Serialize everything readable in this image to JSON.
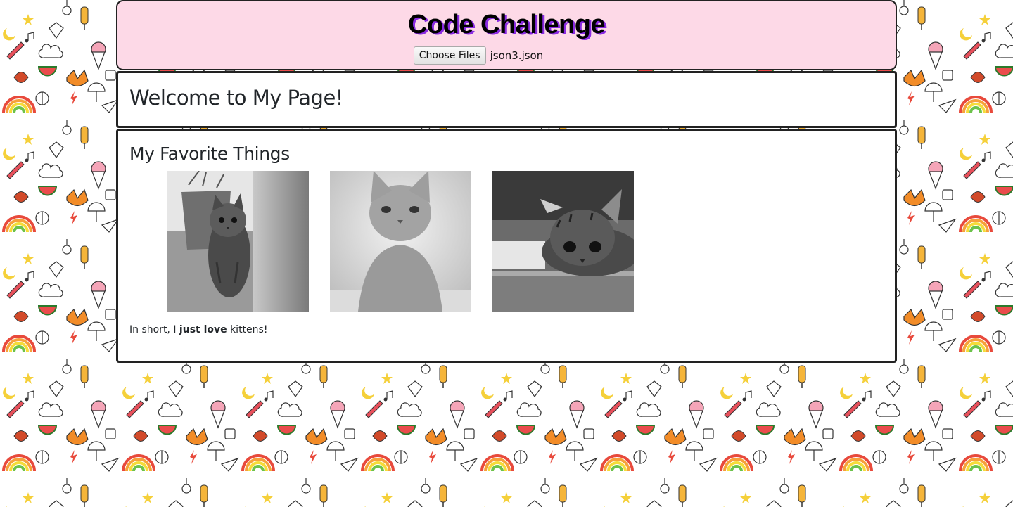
{
  "header": {
    "title": "Code Challenge",
    "file_button_label": "Choose Files",
    "file_name": "json3.json"
  },
  "welcome": {
    "heading": "Welcome to My Page!"
  },
  "favorites": {
    "heading": "My Favorite Things",
    "images": [
      {
        "name": "kitten-image-1"
      },
      {
        "name": "kitten-image-2"
      },
      {
        "name": "kitten-image-3"
      }
    ],
    "summary_prefix": "In short, I ",
    "summary_bold": "just love",
    "summary_suffix": " kittens!"
  },
  "colors": {
    "header_bg": "#fdd9e7",
    "title_shadow": "#8a2be2",
    "border": "#222222"
  }
}
